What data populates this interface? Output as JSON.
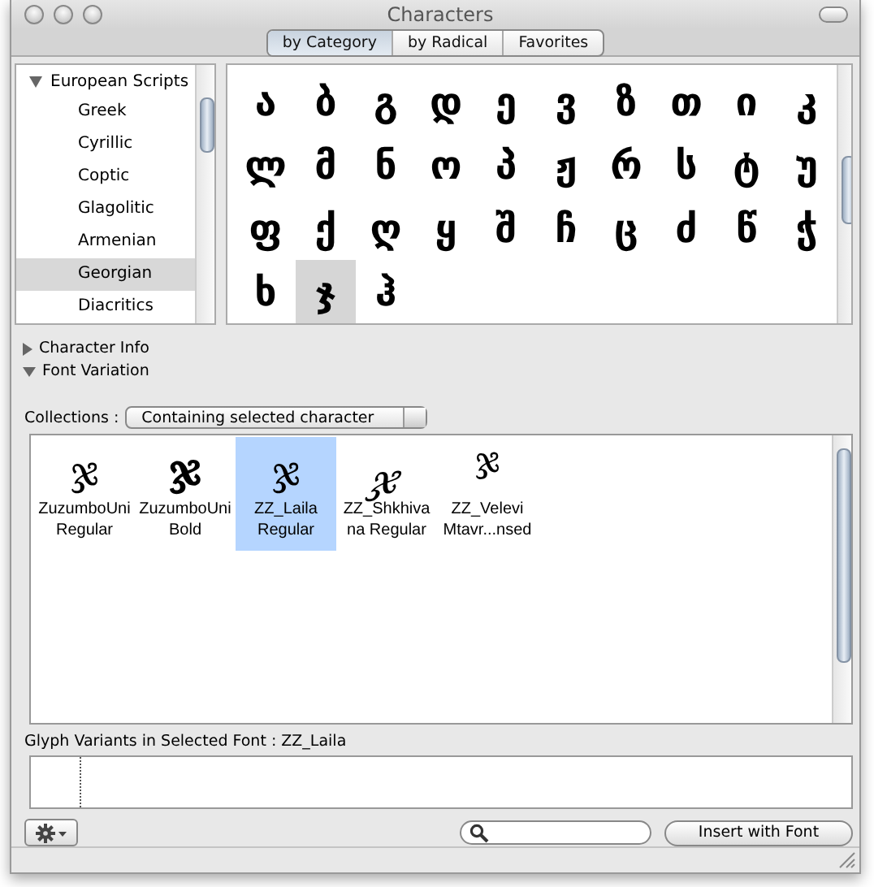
{
  "window": {
    "title": "Characters"
  },
  "view_tabs": [
    {
      "label": "by Category",
      "selected": true
    },
    {
      "label": "by Radical",
      "selected": false
    },
    {
      "label": "Favorites",
      "selected": false
    }
  ],
  "sidebar": {
    "items": [
      {
        "label": "European Scripts",
        "expanded": true,
        "children": [
          {
            "label": "Greek",
            "selected": false
          },
          {
            "label": "Cyrillic",
            "selected": false
          },
          {
            "label": "Coptic",
            "selected": false
          },
          {
            "label": "Glagolitic",
            "selected": false
          },
          {
            "label": "Armenian",
            "selected": false
          },
          {
            "label": "Georgian",
            "selected": true
          },
          {
            "label": "Diacritics",
            "selected": false
          }
        ]
      }
    ]
  },
  "characters": [
    {
      "char": "ა",
      "selected": false
    },
    {
      "char": "ბ",
      "selected": false
    },
    {
      "char": "გ",
      "selected": false
    },
    {
      "char": "დ",
      "selected": false
    },
    {
      "char": "ე",
      "selected": false
    },
    {
      "char": "ვ",
      "selected": false
    },
    {
      "char": "ზ",
      "selected": false
    },
    {
      "char": "თ",
      "selected": false
    },
    {
      "char": "ი",
      "selected": false
    },
    {
      "char": "კ",
      "selected": false
    },
    {
      "char": "ლ",
      "selected": false
    },
    {
      "char": "მ",
      "selected": false
    },
    {
      "char": "ნ",
      "selected": false
    },
    {
      "char": "ო",
      "selected": false
    },
    {
      "char": "პ",
      "selected": false
    },
    {
      "char": "ჟ",
      "selected": false
    },
    {
      "char": "რ",
      "selected": false
    },
    {
      "char": "ს",
      "selected": false
    },
    {
      "char": "ტ",
      "selected": false
    },
    {
      "char": "უ",
      "selected": false
    },
    {
      "char": "ფ",
      "selected": false
    },
    {
      "char": "ქ",
      "selected": false
    },
    {
      "char": "ღ",
      "selected": false
    },
    {
      "char": "ყ",
      "selected": false
    },
    {
      "char": "შ",
      "selected": false
    },
    {
      "char": "ჩ",
      "selected": false
    },
    {
      "char": "ც",
      "selected": false
    },
    {
      "char": "ძ",
      "selected": false
    },
    {
      "char": "წ",
      "selected": false
    },
    {
      "char": "ჭ",
      "selected": false
    },
    {
      "char": "ხ",
      "selected": false
    },
    {
      "char": "ჯ",
      "selected": true
    },
    {
      "char": "ჰ",
      "selected": false
    }
  ],
  "sections": [
    {
      "label": "Character Info",
      "expanded": false
    },
    {
      "label": "Font Variation",
      "expanded": true
    }
  ],
  "collections": {
    "label": "Collections :",
    "value": "Containing selected character"
  },
  "fonts": [
    {
      "glyph": "ჯ",
      "lines": [
        "ZuzumboUni",
        "Regular"
      ],
      "selected": false
    },
    {
      "glyph": "ჯ",
      "lines": [
        "ZuzumboUni",
        "Bold"
      ],
      "selected": false
    },
    {
      "glyph": "ჯ",
      "lines": [
        "ZZ_Laila",
        "Regular"
      ],
      "selected": true
    },
    {
      "glyph": "ჯ",
      "lines": [
        "ZZ_Shkhiva",
        "na Regular"
      ],
      "selected": false
    },
    {
      "glyph": "ჯ",
      "lines": [
        "ZZ_Velevi",
        "Mtavr...nsed"
      ],
      "selected": false
    }
  ],
  "glyph_variants": {
    "label": "Glyph Variants in Selected Font : ZZ_Laila"
  },
  "insert_button": "Insert with Font"
}
